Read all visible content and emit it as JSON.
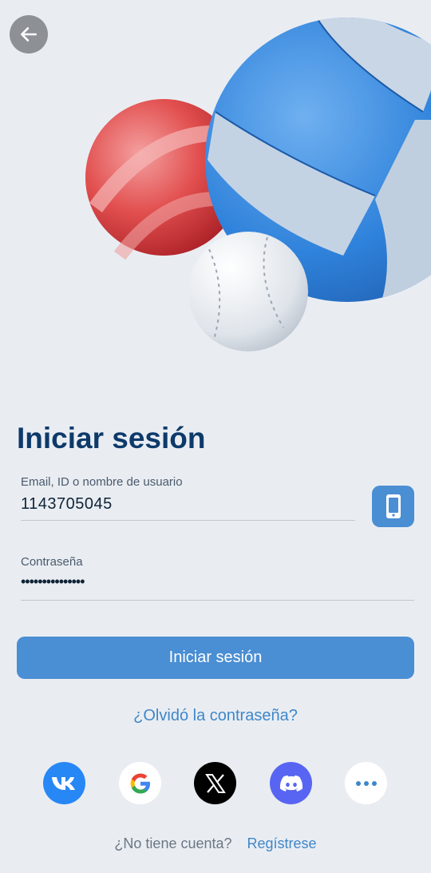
{
  "header": {
    "back_icon": "arrow-left-icon"
  },
  "login": {
    "title": "Iniciar sesión",
    "username": {
      "label": "Email, ID o nombre de usuario",
      "value": "1143705045"
    },
    "password": {
      "label": "Contraseña",
      "value": "•••••••••••••••"
    },
    "phone_icon": "smartphone-icon",
    "submit_label": "Iniciar sesión",
    "forgot_label": "¿Olvidó la contraseña?",
    "no_account_text": "¿No tiene cuenta?",
    "register_label": "Regístrese"
  },
  "social": [
    "vk-icon",
    "google-icon",
    "x-icon",
    "discord-icon",
    "more-icon"
  ],
  "colors": {
    "accent": "#4a8ed3",
    "title": "#0d3a6a",
    "link": "#3f87c9",
    "background": "#e9edf2"
  }
}
